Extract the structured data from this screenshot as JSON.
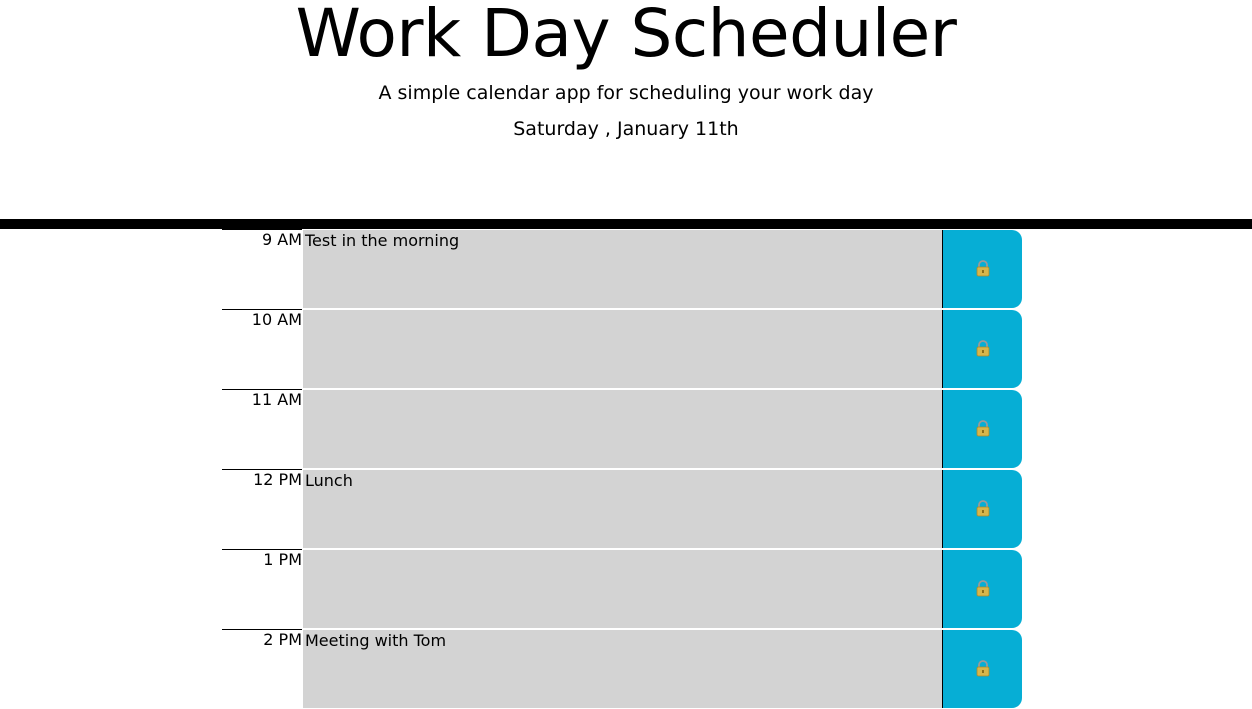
{
  "header": {
    "title": "Work Day Scheduler",
    "subtitle": "A simple calendar app for scheduling your work day",
    "current_day": "Saturday , January 11th"
  },
  "colors": {
    "description_background": "#d3d3d3",
    "save_button": "#06aed5",
    "divider": "#000000"
  },
  "time_blocks": [
    {
      "hour": "9 AM",
      "text": "Test in the morning",
      "save_icon": "lock-icon"
    },
    {
      "hour": "10 AM",
      "text": "",
      "save_icon": "lock-icon"
    },
    {
      "hour": "11 AM",
      "text": "",
      "save_icon": "lock-icon"
    },
    {
      "hour": "12 PM",
      "text": "Lunch",
      "save_icon": "lock-icon"
    },
    {
      "hour": "1 PM",
      "text": "",
      "save_icon": "lock-icon"
    },
    {
      "hour": "2 PM",
      "text": "Meeting with Tom",
      "save_icon": "lock-icon"
    }
  ]
}
